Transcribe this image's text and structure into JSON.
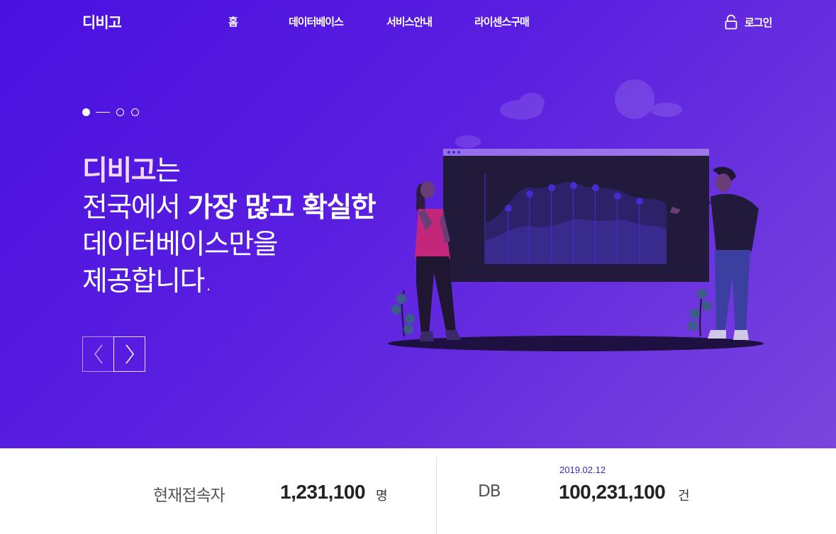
{
  "header": {
    "logo": "디비고",
    "nav": [
      {
        "label": "홈"
      },
      {
        "label": "데이터베이스"
      },
      {
        "label": "서비스안내"
      },
      {
        "label": "라이센스구매"
      }
    ],
    "login_label": "로그인",
    "login_icon": "lock-icon"
  },
  "hero": {
    "slide_indicator": {
      "total": 3,
      "active": 1
    },
    "headline": {
      "brand": "디비고",
      "line1_rest": "는",
      "line2_prefix": "전국에서 ",
      "line2_bold": "가장 많고 확실한",
      "line3": "데이터베이스만을",
      "line4": "제공합니다."
    },
    "prev_icon": "chevron-left-icon",
    "next_icon": "chevron-right-icon",
    "colors": {
      "gradient_start": "#4a10e0",
      "gradient_end": "#7a45dd",
      "brand_text": "#f2d9ff"
    }
  },
  "stats": {
    "visitors": {
      "label": "현재접속자",
      "value": "1,231,100",
      "unit": "명"
    },
    "db": {
      "label": "DB",
      "date": "2019.02.12",
      "value": "100,231,100",
      "unit": "건"
    }
  }
}
